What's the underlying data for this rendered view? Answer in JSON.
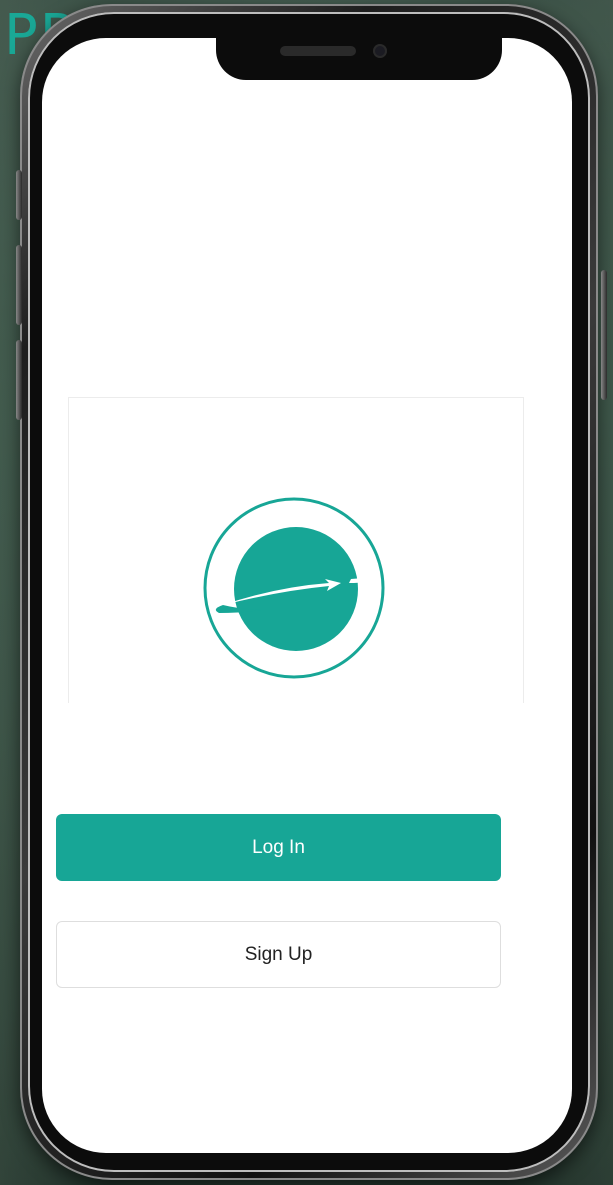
{
  "background": {
    "partial_text": "PP"
  },
  "colors": {
    "accent": "#17a696",
    "screen_background": "#ffffff",
    "bezel": "#0c0c0c"
  },
  "splash": {
    "logo_icon": "globe-arrow-logo-icon"
  },
  "auth": {
    "login_label": "Log In",
    "signup_label": "Sign Up"
  }
}
